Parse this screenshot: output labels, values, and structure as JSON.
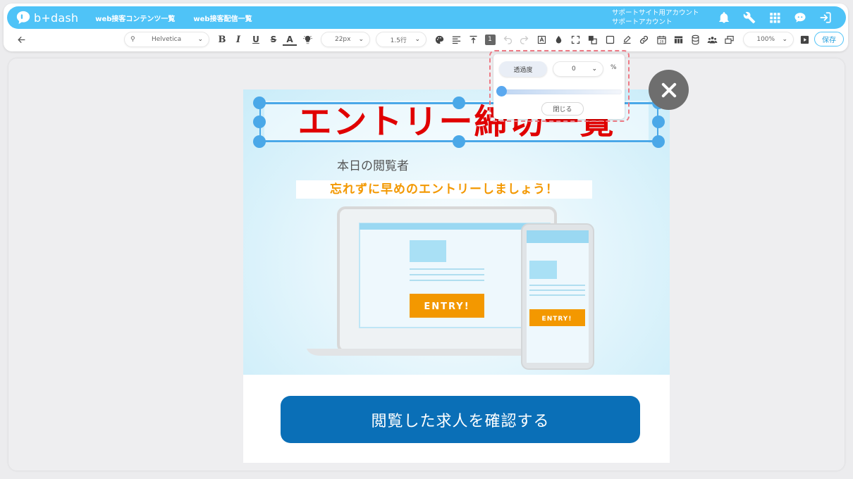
{
  "app": {
    "logo_text": "b+dash",
    "nav": [
      "web接客コンテンツ一覧",
      "web接客配信一覧"
    ],
    "account_line1": "サポートサイト用アカウント",
    "account_line2": "サポートアカウント"
  },
  "toolbar": {
    "font_family": "Helvetica",
    "font_size": "22px",
    "line_height": "1.5行",
    "layer_number": "1",
    "calendar_day": "28",
    "zoom": "100%",
    "save_label": "保存",
    "underline_label": "U",
    "text_color_label": "A"
  },
  "opacity_panel": {
    "label": "透過度",
    "value": "0",
    "unit": "%",
    "slider_value": 0,
    "close_label": "閉じる"
  },
  "banner": {
    "headline": "エントリー締切一覧",
    "viewers_label": "本日の閲覧者",
    "reminder": "忘れずに早めのエントリーしましょう！",
    "entry_label": "ENTRY!",
    "cta_label": "閲覧した求人を確認する"
  },
  "colors": {
    "brand": "#4fc3f7",
    "headline": "#e00000",
    "reminder": "#f39800",
    "cta": "#0a6fb7",
    "entry": "#f39800",
    "selection": "#4aa8e8"
  }
}
